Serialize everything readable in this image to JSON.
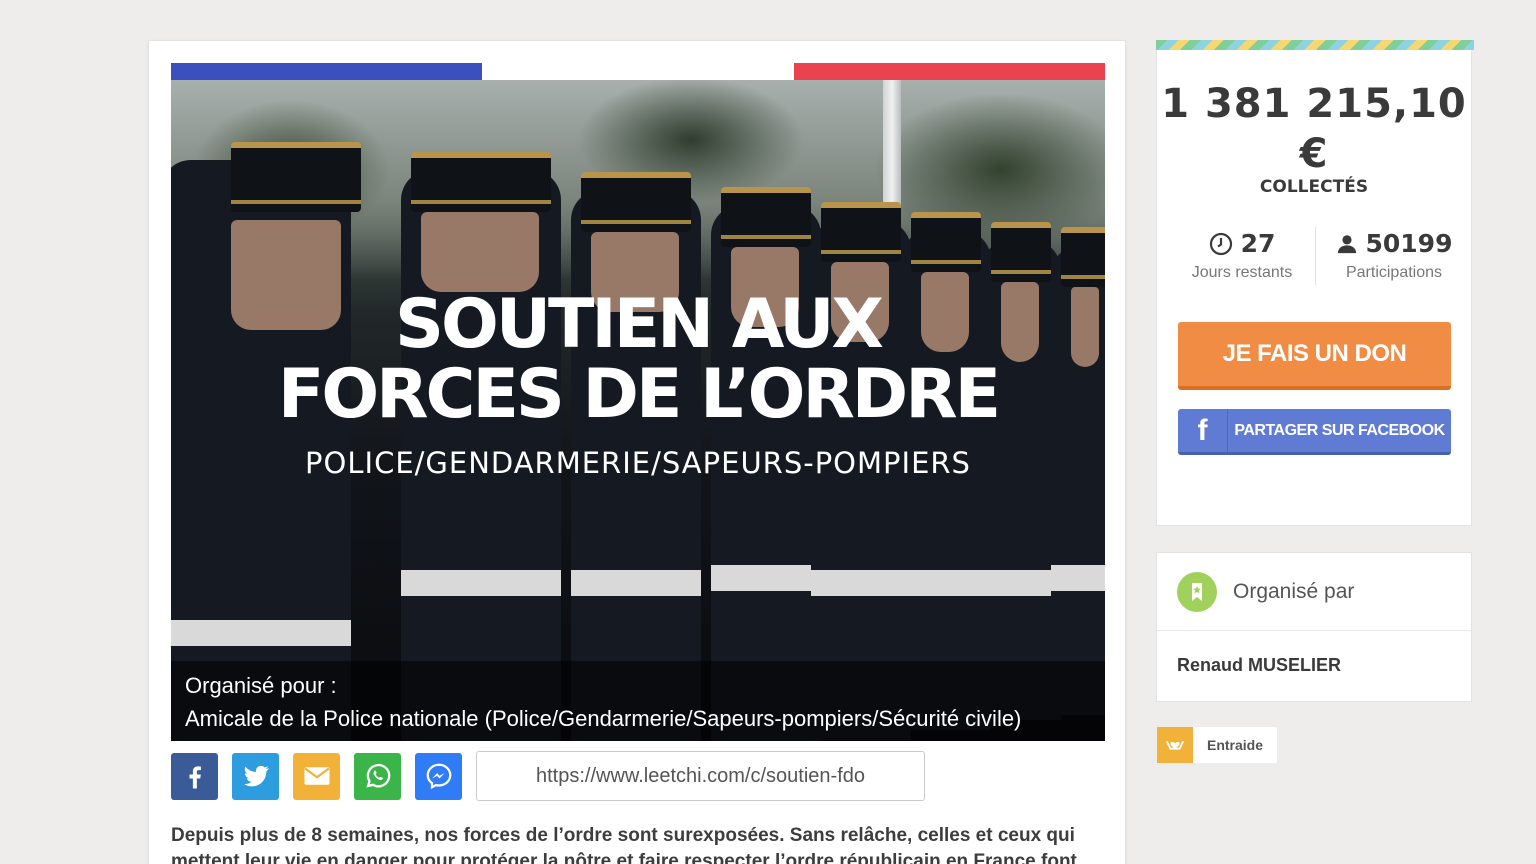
{
  "colors": {
    "flag_blue": "#3b4fbf",
    "flag_white": "#ffffff",
    "flag_red": "#e8434e",
    "donate": "#f08c43",
    "facebook": "#5f7bd3",
    "twitter": "#2d9de0",
    "email": "#f2b23a",
    "whatsapp": "#3bb54a",
    "messenger": "#2f7cf6"
  },
  "hero": {
    "title_line1": "SOUTIEN AUX",
    "title_line2": "FORCES DE L’ORDRE",
    "subtitle": "POLICE/GENDARMERIE/SAPEURS-POMPIERS",
    "beneficiary_label": "Organisé pour :",
    "beneficiary_name": "Amicale de la Police nationale (Police/Gendarmerie/Sapeurs-pompiers/Sécurité civile)"
  },
  "share": {
    "icons": [
      "facebook-icon",
      "twitter-icon",
      "email-icon",
      "whatsapp-icon",
      "messenger-icon"
    ],
    "url": "https://www.leetchi.com/c/soutien-fdo"
  },
  "description": "Depuis plus de 8 semaines, nos forces de l’ordre sont surexposées. Sans relâche, celles et ceux qui mettent leur vie en danger pour protéger la nôtre et faire respecter l’ordre républicain en France font",
  "stats": {
    "amount_line1": "1 381 215,10",
    "amount_line2": "€",
    "collected_label": "COLLECTÉS",
    "days_value": "27",
    "days_label": "Jours restants",
    "participants_value": "50199",
    "participants_label": "Participations",
    "donate_button": "JE FAIS UN DON",
    "facebook_button": "PARTAGER SUR FACEBOOK"
  },
  "organizer": {
    "label": "Organisé par",
    "name": "Renaud MUSELIER"
  },
  "category": {
    "label": "Entraide"
  }
}
